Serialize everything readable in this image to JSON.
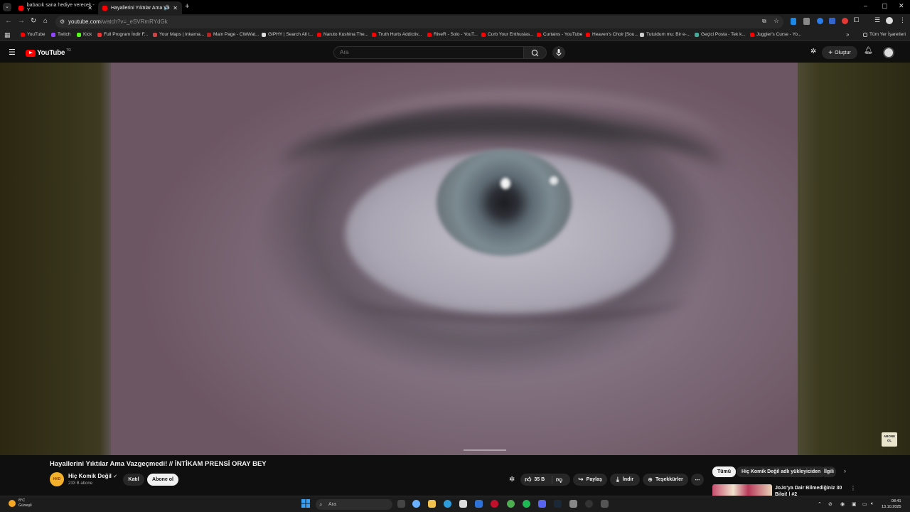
{
  "browser": {
    "tabs": [
      {
        "title": "babacık sana hediye verecek - Y",
        "active": false
      },
      {
        "title": "Hayallerini Yıktılar Ama Va",
        "active": true
      }
    ],
    "url_host": "youtube.com",
    "url_path": "/watch?v=_eSVRmRYdGk",
    "bookmarks": [
      {
        "label": "YouTube",
        "color": "#ff0000"
      },
      {
        "label": "Twitch",
        "color": "#9146ff"
      },
      {
        "label": "Kick",
        "color": "#53fc18"
      },
      {
        "label": "Full Program İndir F...",
        "color": "#e33"
      },
      {
        "label": "Your Maps | Inkarna...",
        "color": "#c44"
      },
      {
        "label": "Main Page - CWWat...",
        "color": "#b22"
      },
      {
        "label": "GIPHY | Search All t...",
        "color": "#ddd"
      },
      {
        "label": "Naruto Kushina The...",
        "color": "#ff0000"
      },
      {
        "label": "Truth Hurts Addictiv...",
        "color": "#ff0000"
      },
      {
        "label": "RiveR - Solo - YouT...",
        "color": "#ff0000"
      },
      {
        "label": "Curb Your Enthusias...",
        "color": "#ff0000"
      },
      {
        "label": "Curtains - YouTube",
        "color": "#ff0000"
      },
      {
        "label": "Heaven's Choir [Sou...",
        "color": "#ff0000"
      },
      {
        "label": "Tutuldum mu: Bir e-...",
        "color": "#ccc"
      },
      {
        "label": "Geçici Posta - Tek k...",
        "color": "#4a9"
      },
      {
        "label": "Juggler's Curse - Yo...",
        "color": "#ff0000"
      }
    ],
    "all_bookmarks": "Tüm Yer İşaretleri"
  },
  "youtube": {
    "logo_text": "YouTube",
    "region": "TR",
    "search_placeholder": "Ara",
    "create_label": "Oluştur",
    "video": {
      "title": "Hayallerini Yıktılar Ama Vazgeçmedi! // İNTİKAM PRENSİ ORAY BEY",
      "channel": "Hiç Komik Değil",
      "subscribers": "233 B abone",
      "join_label": "Katıl",
      "subscribe_label": "Abone ol",
      "likes": "35 B",
      "share_label": "Paylaş",
      "download_label": "İndir",
      "thanks_label": "Teşekkürler",
      "watermark": "ABONE OL",
      "avatar_text": "HKD"
    },
    "chips": [
      "Tümü",
      "Hiç Komik Değil adlı yükleyiciden",
      "İlgili"
    ],
    "recommended": {
      "title": "JoJo'ya Dair Bilmediğiniz 30 Bilgi! | #2"
    }
  },
  "taskbar": {
    "temperature": "8°C",
    "weather": "Güneşli",
    "search_placeholder": "Ara",
    "time": "08:41",
    "date": "13.10.2025"
  }
}
